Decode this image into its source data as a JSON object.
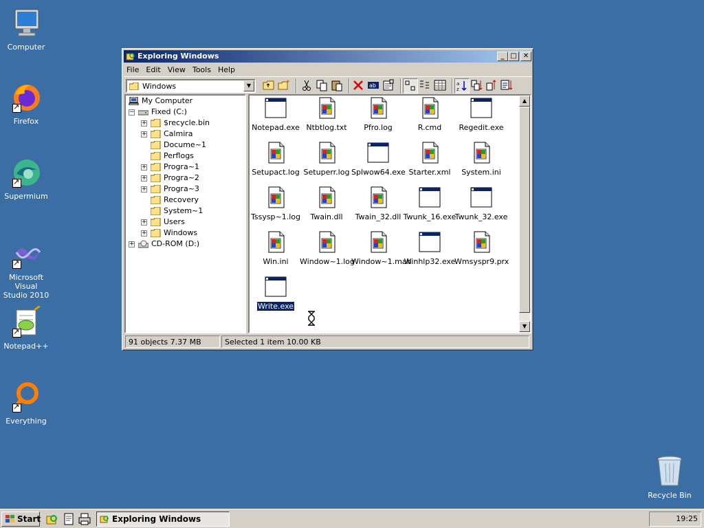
{
  "desktop": {
    "icons": [
      {
        "label": "Computer",
        "icon": "computer-icon"
      },
      {
        "label": "Firefox",
        "icon": "firefox-icon"
      },
      {
        "label": "Supermium",
        "icon": "supermium-icon"
      },
      {
        "label_line1": "Microsoft Visual",
        "label_line2": "Studio 2010",
        "icon": "visual-studio-icon"
      },
      {
        "label": "Notepad++",
        "icon": "notepadpp-icon"
      },
      {
        "label": "Everything",
        "icon": "everything-icon"
      },
      {
        "label": "Recycle Bin",
        "icon": "recycle-bin-icon"
      }
    ]
  },
  "window": {
    "title": "Exploring Windows",
    "buttons": {
      "minimize": "_",
      "maximize": "□",
      "close": "✕"
    },
    "menu": [
      "File",
      "Edit",
      "View",
      "Tools",
      "Help"
    ],
    "address": "Windows",
    "tree": [
      {
        "label": "My Computer",
        "icon": "computer-icon"
      },
      {
        "label": "Fixed (C:)",
        "icon": "drive-icon",
        "expander": "−"
      },
      {
        "label": "$recycle.bin",
        "expander": "+"
      },
      {
        "label": "Calmira",
        "expander": "+"
      },
      {
        "label": "Docume~1"
      },
      {
        "label": "Perflogs"
      },
      {
        "label": "Progra~1",
        "expander": "+"
      },
      {
        "label": "Progra~2",
        "expander": "+"
      },
      {
        "label": "Progra~3",
        "expander": "+"
      },
      {
        "label": "Recovery"
      },
      {
        "label": "System~1"
      },
      {
        "label": "Users",
        "expander": "+"
      },
      {
        "label": "Windows",
        "expander": "+",
        "open": true
      },
      {
        "label": "CD-ROM (D:)",
        "icon": "cdrom-icon",
        "expander": "+"
      }
    ],
    "files": [
      {
        "name": "Notepad.exe",
        "icon": "exe-window-icon"
      },
      {
        "name": "Ntbtlog.txt",
        "icon": "document-icon"
      },
      {
        "name": "Pfro.log",
        "icon": "document-icon"
      },
      {
        "name": "R.cmd",
        "icon": "document-icon"
      },
      {
        "name": "Regedit.exe",
        "icon": "exe-window-icon"
      },
      {
        "name": "Setupact.log",
        "icon": "document-icon"
      },
      {
        "name": "Setuperr.log",
        "icon": "document-icon"
      },
      {
        "name": "Splwow64.exe",
        "icon": "exe-window-icon"
      },
      {
        "name": "Starter.xml",
        "icon": "document-icon"
      },
      {
        "name": "System.ini",
        "icon": "document-icon"
      },
      {
        "name": "Tssysp~1.log",
        "icon": "document-icon"
      },
      {
        "name": "Twain.dll",
        "icon": "document-icon"
      },
      {
        "name": "Twain_32.dll",
        "icon": "document-icon"
      },
      {
        "name": "Twunk_16.exe",
        "icon": "exe-window-icon"
      },
      {
        "name": "Twunk_32.exe",
        "icon": "exe-window-icon"
      },
      {
        "name": "Win.ini",
        "icon": "document-icon"
      },
      {
        "name": "Window~1.log",
        "icon": "document-icon"
      },
      {
        "name": "Window~1.man",
        "icon": "document-icon"
      },
      {
        "name": "Winhlp32.exe",
        "icon": "exe-window-icon"
      },
      {
        "name": "Wmsyspr9.prx",
        "icon": "document-icon"
      },
      {
        "name": "Write.exe",
        "icon": "exe-window-icon",
        "selected": true
      }
    ],
    "status": {
      "objects": "91 objects  7.37 MB",
      "selection": "Selected 1 item  10.00 KB"
    }
  },
  "taskbar": {
    "start_label": "Start",
    "task_label": "Exploring Windows",
    "clock": "19:25"
  },
  "colors": {
    "desktop": "#3a6ea5",
    "titlebar_start": "#0a246a",
    "titlebar_end": "#a6caf0",
    "face": "#d4d0c8",
    "selection": "#0a246a"
  }
}
